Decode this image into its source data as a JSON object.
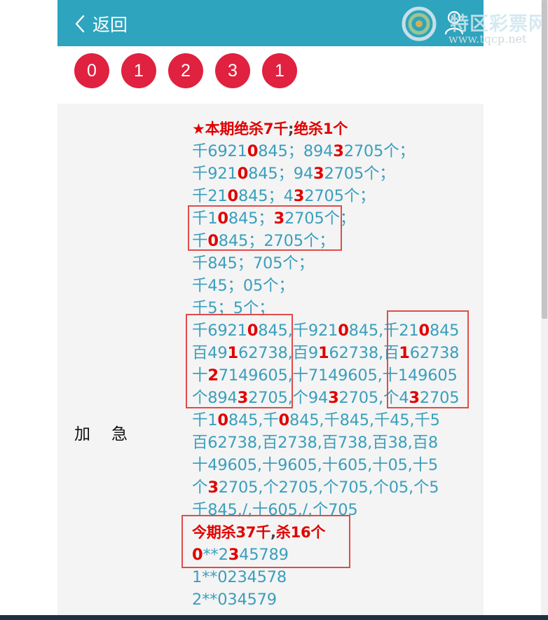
{
  "header": {
    "back_label": "返回",
    "bg_color": "#2ea4be"
  },
  "balls": [
    "0",
    "1",
    "2",
    "3",
    "1"
  ],
  "ball_color": "#e0213f",
  "row_label": "加急",
  "lines": [
    {
      "head": true,
      "segs": [
        {
          "t": "★本期绝杀7千"
        },
        {
          "t": ";",
          "cls": "dk"
        },
        {
          "t": "绝杀1个"
        }
      ]
    },
    {
      "segs": [
        {
          "t": "千6921"
        },
        {
          "t": "0",
          "cls": "hl"
        },
        {
          "t": "845；894"
        },
        {
          "t": "3",
          "cls": "hl"
        },
        {
          "t": "2705个；"
        }
      ]
    },
    {
      "segs": [
        {
          "t": "千921"
        },
        {
          "t": "0",
          "cls": "hl"
        },
        {
          "t": "845；94"
        },
        {
          "t": "3",
          "cls": "hl"
        },
        {
          "t": "2705个；"
        }
      ]
    },
    {
      "segs": [
        {
          "t": "千21"
        },
        {
          "t": "0",
          "cls": "hl"
        },
        {
          "t": "845；4"
        },
        {
          "t": "3",
          "cls": "hl"
        },
        {
          "t": "2705个；"
        }
      ]
    },
    {
      "segs": [
        {
          "t": "千1"
        },
        {
          "t": "0",
          "cls": "hl"
        },
        {
          "t": "845；"
        },
        {
          "t": "3",
          "cls": "hl"
        },
        {
          "t": "2705个；"
        }
      ]
    },
    {
      "segs": [
        {
          "t": "千"
        },
        {
          "t": "0",
          "cls": "hl"
        },
        {
          "t": "845；2705个；"
        }
      ]
    },
    {
      "segs": [
        {
          "t": "千845；705个；"
        }
      ]
    },
    {
      "segs": [
        {
          "t": "千45；05个；"
        }
      ]
    },
    {
      "segs": [
        {
          "t": "千5；5个；"
        }
      ]
    },
    {
      "segs": [
        {
          "t": "千6921"
        },
        {
          "t": "0",
          "cls": "hl"
        },
        {
          "t": "845,千921"
        },
        {
          "t": "0",
          "cls": "hl"
        },
        {
          "t": "845,千21"
        },
        {
          "t": "0",
          "cls": "hl"
        },
        {
          "t": "845"
        }
      ]
    },
    {
      "segs": [
        {
          "t": "百49"
        },
        {
          "t": "1",
          "cls": "hl"
        },
        {
          "t": "62738,百9"
        },
        {
          "t": "1",
          "cls": "hl"
        },
        {
          "t": "62738,百"
        },
        {
          "t": "1",
          "cls": "hl"
        },
        {
          "t": "62738"
        }
      ]
    },
    {
      "segs": [
        {
          "t": "十"
        },
        {
          "t": "2",
          "cls": "hl"
        },
        {
          "t": "7149605,十7149605,十149605"
        }
      ]
    },
    {
      "segs": [
        {
          "t": "个894"
        },
        {
          "t": "3",
          "cls": "hl"
        },
        {
          "t": "2705,个94"
        },
        {
          "t": "3",
          "cls": "hl"
        },
        {
          "t": "2705,个4"
        },
        {
          "t": "3",
          "cls": "hl"
        },
        {
          "t": "2705"
        }
      ]
    },
    {
      "segs": [
        {
          "t": "千1"
        },
        {
          "t": "0",
          "cls": "hl"
        },
        {
          "t": "845,千"
        },
        {
          "t": "0",
          "cls": "hl"
        },
        {
          "t": "845,千845,千45,千5"
        }
      ]
    },
    {
      "segs": [
        {
          "t": "百62738,百2738,百738,百38,百8"
        }
      ]
    },
    {
      "segs": [
        {
          "t": "十49605,十9605,十605,十05,十5"
        }
      ]
    },
    {
      "segs": [
        {
          "t": "个"
        },
        {
          "t": "3",
          "cls": "hl"
        },
        {
          "t": "2705,个2705,个705,个05,个5"
        }
      ]
    },
    {
      "segs": [
        {
          "t": "千845,/,十605,/,个705"
        }
      ]
    },
    {
      "head": true,
      "segs": [
        {
          "t": "今期杀37千"
        },
        {
          "t": ",",
          "cls": "dk"
        },
        {
          "t": "杀16个"
        }
      ]
    },
    {
      "segs": [
        {
          "t": "0",
          "cls": "hl"
        },
        {
          "t": "**2"
        },
        {
          "t": "3",
          "cls": "hl"
        },
        {
          "t": "45789"
        }
      ]
    },
    {
      "segs": [
        {
          "t": "1**0234578"
        }
      ]
    },
    {
      "segs": [
        {
          "t": "2**034579"
        }
      ]
    }
  ],
  "watermark": {
    "title": "特区彩票网",
    "url": "www.tqcp.net"
  }
}
